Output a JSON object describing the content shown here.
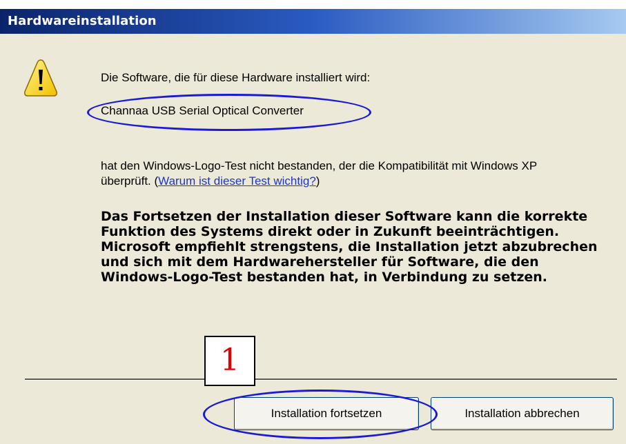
{
  "window": {
    "title": "Hardwareinstallation"
  },
  "icons": {
    "warning": "warning-icon"
  },
  "content": {
    "intro": "Die Software, die für diese Hardware installiert wird:",
    "device_name": "Channaa USB Serial Optical Converter",
    "message_part1": "hat den Windows-Logo-Test nicht bestanden, der die Kompatibilität mit Windows XP überprüft. (",
    "message_link": "Warum ist dieser Test wichtig?",
    "message_part2": ")",
    "warning_bold": "Das Fortsetzen der Installation dieser Software kann die korrekte Funktion des Systems direkt oder in Zukunft beeinträchtigen. Microsoft empfiehlt strengstens, die Installation jetzt abzubrechen und sich mit dem Hardwarehersteller für Software, die den Windows-Logo-Test bestanden hat, in Verbindung zu setzen."
  },
  "buttons": {
    "continue_label": "Installation fortsetzen",
    "cancel_label": "Installation abbrechen"
  },
  "annotation": {
    "number": "1",
    "number_color": "#e00000",
    "ellipse_color": "#1a1ad6"
  }
}
